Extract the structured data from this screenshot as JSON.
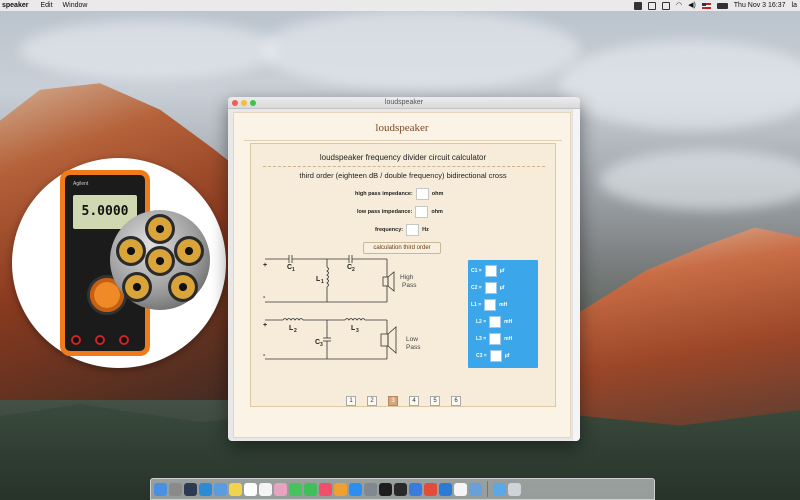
{
  "menubar": {
    "app_name": "speaker",
    "menus": [
      "Edit",
      "Window"
    ],
    "clock": "Thu Nov 3  16:37",
    "user": "la"
  },
  "window": {
    "title": "loudspeaker",
    "app_heading": "loudspeaker",
    "calculator_title": "loudspeaker frequency divider circuit calculator",
    "subtitle": "third order (eighteen dB / double frequency) bidirectional cross",
    "fields": {
      "high_pass_label": "high pass impedance:",
      "high_pass_unit": "ohm",
      "high_pass_value": "",
      "low_pass_label": "low pass impedance:",
      "low_pass_unit": "ohm",
      "low_pass_value": "",
      "frequency_label": "frequency:",
      "frequency_unit": "Hz",
      "frequency_value": ""
    },
    "calc_button": "calculation third order",
    "circuit": {
      "high": {
        "plus": "+",
        "minus": "-",
        "c1": "C",
        "c1_sub": "1",
        "c2": "C",
        "c2_sub": "2",
        "l1": "L",
        "l1_sub": "1",
        "label1": "High",
        "label2": "Pass"
      },
      "low": {
        "plus": "+",
        "minus": "-",
        "l2": "L",
        "l2_sub": "2",
        "l3": "L",
        "l3_sub": "3",
        "c3": "C",
        "c3_sub": "3",
        "label1": "Low",
        "label2": "Pass"
      }
    },
    "results": [
      {
        "label": "C1 =",
        "unit": "μf"
      },
      {
        "label": "C2 =",
        "unit": "μf"
      },
      {
        "label": "L1 =",
        "unit": "mH"
      },
      {
        "label": "L2 =",
        "unit": "mH"
      },
      {
        "label": "L3 =",
        "unit": "mH"
      },
      {
        "label": "C3 =",
        "unit": "μf"
      }
    ],
    "pages": [
      "1",
      "2",
      "3",
      "4",
      "5",
      "6"
    ],
    "active_page": "3"
  },
  "app_icon": {
    "meter_reading": "5.0000",
    "brand": "Agilent"
  },
  "colors": {
    "results_panel": "#3ba6ea",
    "active_page": "#d9a67a",
    "heading": "#7a4a2a"
  },
  "dock_icons": [
    "finder-icon",
    "launchpad-icon",
    "mission-control-icon",
    "safari-icon",
    "mail-icon",
    "notes-icon",
    "calendar-icon",
    "reminders-icon",
    "photos-icon",
    "messages-icon",
    "facetime-icon",
    "music-icon",
    "books-icon",
    "appstore-icon",
    "preferences-icon",
    "terminal-icon",
    "activity-icon",
    "xcode-icon",
    "chrome-icon",
    "vscode-icon",
    "textedit-icon",
    "preview-icon",
    "folder-icon",
    "trash-icon"
  ]
}
